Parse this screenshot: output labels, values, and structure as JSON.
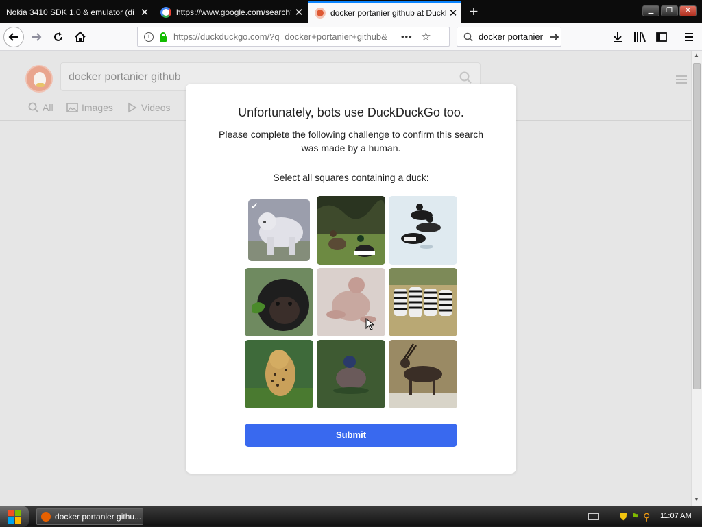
{
  "tabs": [
    {
      "title": "Nokia 3410 SDK 1.0 & emulator (di",
      "favicon_color": "#2a7bd1",
      "active": false
    },
    {
      "title": "https://www.google.com/search?",
      "favicon_color": "#4285f4",
      "active": false
    },
    {
      "title": "docker portanier github at DuckDu",
      "favicon_color": "#de5833",
      "active": true
    }
  ],
  "toolbar": {
    "url": "https://duckduckgo.com/?q=docker+portanier+github&",
    "search_value": "docker portanier",
    "more_label": "•••"
  },
  "ddg": {
    "search_value": "docker portanier github",
    "tabs": [
      "All",
      "Images",
      "Videos"
    ]
  },
  "captcha": {
    "title": "Unfortunately, bots use DuckDuckGo too.",
    "subtitle": "Please complete the following challenge to confirm this search was made by a human.",
    "instruction": "Select all squares containing a duck:",
    "tiles": [
      {
        "subject": "polar bear",
        "selected": true
      },
      {
        "subject": "two ducks in grass",
        "selected": false
      },
      {
        "subject": "ducks on water",
        "selected": false
      },
      {
        "subject": "baby gorilla",
        "selected": false
      },
      {
        "subject": "hairless animal",
        "selected": false
      },
      {
        "subject": "zebras",
        "selected": false
      },
      {
        "subject": "cheetah",
        "selected": false
      },
      {
        "subject": "duck swimming",
        "selected": false
      },
      {
        "subject": "antelope",
        "selected": false
      }
    ],
    "submit_label": "Submit",
    "submit_color": "#3969ef"
  },
  "taskbar": {
    "window_label": "docker portanier githu...",
    "clock": "11:07 AM"
  }
}
